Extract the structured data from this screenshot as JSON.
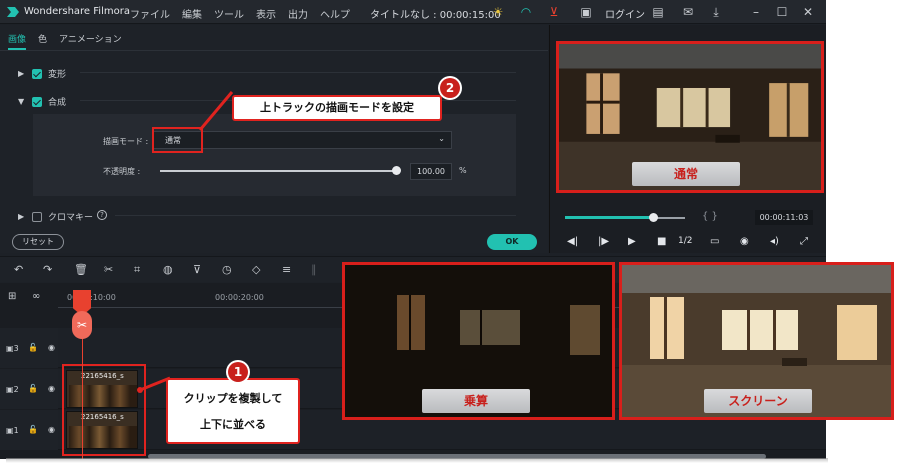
{
  "app": {
    "name": "Wondershare Filmora",
    "menu": [
      "ファイル",
      "編集",
      "ツール",
      "表示",
      "出力",
      "ヘルプ"
    ],
    "doc_title": "タイトルなし : 00:00:15:00",
    "login": "ログイン"
  },
  "inspector": {
    "tabs": [
      "画像",
      "色",
      "アニメーション"
    ],
    "sections": {
      "transform": "変形",
      "composite": "合成",
      "chroma": "クロマキー"
    },
    "blend_mode_label": "描画モード :",
    "blend_mode_value": "通常",
    "opacity_label": "不透明度 :",
    "opacity_value": "100.00",
    "opacity_unit": "%",
    "opacity_level": 1.0,
    "reset": "リセット",
    "ok": "OK"
  },
  "preview": {
    "time": "00:00:11:03",
    "ratio": "1/2",
    "progress": 0.73,
    "braces": "{    }"
  },
  "timeline": {
    "ruler": [
      "00:00:10:00",
      "00:00:20:00"
    ],
    "clips": [
      "22165416_s",
      "22165416_s"
    ],
    "track_labels": [
      "3",
      "2",
      "1"
    ]
  },
  "annotations": {
    "callout1_line1": "クリップを複製して",
    "callout1_line2": "上下に並べる",
    "callout2": "上トラックの描画モードを設定",
    "badge1": "1",
    "badge2": "2"
  },
  "captions": {
    "normal": "通常",
    "multiply": "乗算",
    "screen": "スクリーン"
  },
  "colors": {
    "accent": "#22c1b1",
    "highlight": "#e0231f",
    "playhead": "#e8412f"
  }
}
